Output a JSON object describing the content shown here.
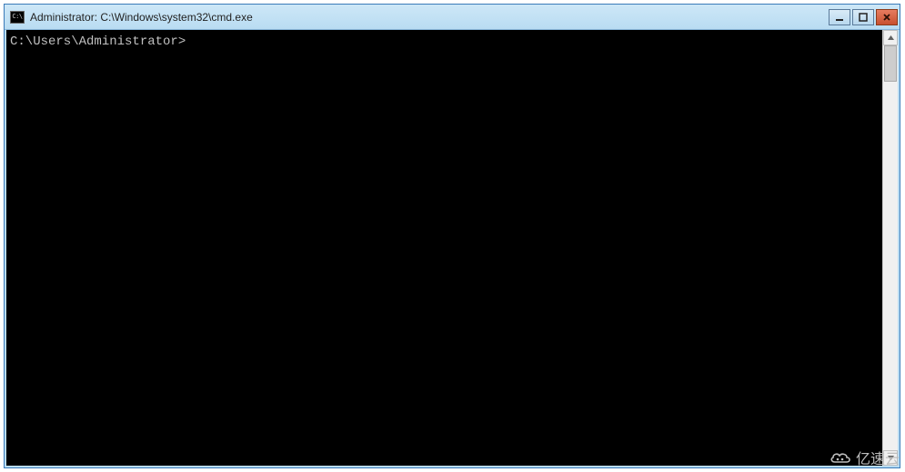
{
  "window": {
    "title": "Administrator: C:\\Windows\\system32\\cmd.exe",
    "icon_label": "C:\\"
  },
  "terminal": {
    "prompt": "C:\\Users\\Administrator>"
  },
  "watermark": {
    "text": "亿速云"
  }
}
